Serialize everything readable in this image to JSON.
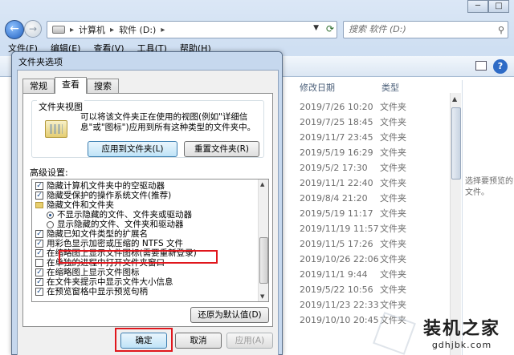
{
  "explorer": {
    "address": {
      "parts": [
        "计算机",
        "软件 (D:)"
      ]
    },
    "search_placeholder": "搜索 软件 (D:)",
    "menu": [
      "文件(F)",
      "编辑(E)",
      "查看(V)",
      "工具(T)",
      "帮助(H)"
    ],
    "columns": {
      "date": "修改日期",
      "type": "类型"
    },
    "rows": [
      {
        "date": "2019/7/26 10:20",
        "type": "文件夹"
      },
      {
        "date": "2019/7/25 18:45",
        "type": "文件夹"
      },
      {
        "date": "2019/11/7 23:45",
        "type": "文件夹"
      },
      {
        "date": "2019/5/19 16:29",
        "type": "文件夹"
      },
      {
        "date": "2019/5/2 17:30",
        "type": "文件夹"
      },
      {
        "date": "2019/11/1 22:40",
        "type": "文件夹"
      },
      {
        "date": "2019/8/4 21:20",
        "type": "文件夹"
      },
      {
        "date": "2019/5/19 11:17",
        "type": "文件夹"
      },
      {
        "date": "2019/11/19 11:57",
        "type": "文件夹"
      },
      {
        "date": "2019/11/5 17:26",
        "type": "文件夹"
      },
      {
        "date": "2019/10/26 22:06",
        "type": "文件夹"
      },
      {
        "date": "2019/11/1 9:44",
        "type": "文件夹"
      },
      {
        "date": "2019/5/22 10:56",
        "type": "文件夹"
      },
      {
        "date": "2019/11/23 22:33",
        "type": "文件夹"
      },
      {
        "date": "2019/10/10 20:45",
        "type": "文件夹"
      }
    ],
    "preview_text": "选择要预览的文件。"
  },
  "watermark": {
    "main": "装机之家",
    "url": "gdhjbk.com"
  },
  "dialog": {
    "title": "文件夹选项",
    "tabs": [
      "常规",
      "查看",
      "搜索"
    ],
    "active_tab": "查看",
    "folder_views": {
      "legend": "文件夹视图",
      "text": "可以将该文件夹正在使用的视图(例如\"详细信息\"或\"图标\")应用到所有这种类型的文件夹中。",
      "apply_button": "应用到文件夹(L)",
      "reset_button": "重置文件夹(R)"
    },
    "advanced_label": "高级设置:",
    "advanced_items": [
      {
        "kind": "checkbox",
        "checked": true,
        "label": "隐藏计算机文件夹中的空驱动器"
      },
      {
        "kind": "checkbox",
        "checked": true,
        "label": "隐藏受保护的操作系统文件(推荐)"
      },
      {
        "kind": "folder",
        "label": "隐藏文件和文件夹"
      },
      {
        "kind": "radio",
        "checked": true,
        "label": "不显示隐藏的文件、文件夹或驱动器"
      },
      {
        "kind": "radio",
        "checked": false,
        "label": "显示隐藏的文件、文件夹和驱动器"
      },
      {
        "kind": "checkbox",
        "checked": true,
        "label": "隐藏已知文件类型的扩展名"
      },
      {
        "kind": "checkbox",
        "checked": true,
        "label": "用彩色显示加密或压缩的 NTFS 文件"
      },
      {
        "kind": "checkbox",
        "checked": true,
        "label": "在缩略图上显示文件图标(需要重新登录)"
      },
      {
        "kind": "checkbox",
        "checked": false,
        "label": "在单独的进程中打开文件夹窗口"
      },
      {
        "kind": "checkbox",
        "checked": true,
        "label": "在缩略图上显示文件图标"
      },
      {
        "kind": "checkbox",
        "checked": true,
        "label": "在文件夹提示中显示文件大小信息"
      },
      {
        "kind": "checkbox",
        "checked": true,
        "label": "在预览窗格中显示预览句柄"
      }
    ],
    "restore_button": "还原为默认值(D)",
    "ok_button": "确定",
    "cancel_button": "取消",
    "apply_button": "应用(A)"
  },
  "colors": {
    "highlight": "#e0161c"
  }
}
